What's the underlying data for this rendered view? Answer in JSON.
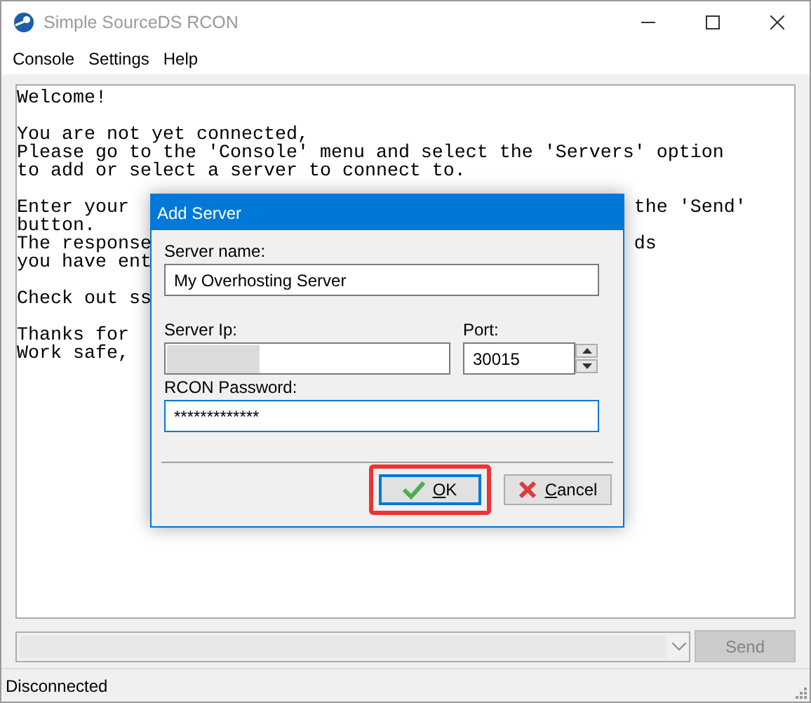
{
  "window": {
    "title": "Simple SourceDS RCON"
  },
  "menu": [
    "Console",
    "Settings",
    "Help"
  ],
  "console": {
    "paragraphs": [
      {
        "lines": [
          {
            "text": "Welcome!"
          }
        ]
      },
      {
        "lines": [
          {
            "text": "You are not yet connected,"
          },
          {
            "text": "Please go to the 'Console' menu and select the 'Servers' option"
          },
          {
            "text": "to add or select a server to connect to."
          }
        ]
      },
      {
        "lines": [
          {
            "text": "Enter your",
            "tail": "the 'Send'"
          },
          {
            "text": "button."
          },
          {
            "text": "The response",
            "tail": "ds"
          },
          {
            "text": "you have ent"
          }
        ]
      },
      {
        "lines": [
          {
            "text": "Check out ss"
          }
        ]
      },
      {
        "lines": [
          {
            "text": "Thanks for"
          },
          {
            "text": "Work safe,"
          }
        ]
      }
    ]
  },
  "command": {
    "disabled": true
  },
  "send_button": {
    "label": "Send",
    "disabled": true
  },
  "status_bar": "Disconnected",
  "dialog": {
    "title": "Add Server",
    "server_name": {
      "label": "Server name:",
      "value": "My Overhosting Server",
      "focused": false
    },
    "server_ip": {
      "label": "Server Ip:",
      "redacted": true,
      "focused": false
    },
    "port": {
      "label": "Port:",
      "value": "30015",
      "focused": false
    },
    "rcon_password": {
      "label": "RCON Password:",
      "value": "*************",
      "focused": true
    },
    "buttons": [
      {
        "kind": "ok",
        "label": "OK",
        "focused": true,
        "highlighted": true
      },
      {
        "kind": "cancel",
        "label": "Cancel",
        "focused": false,
        "highlighted": false
      }
    ]
  }
}
